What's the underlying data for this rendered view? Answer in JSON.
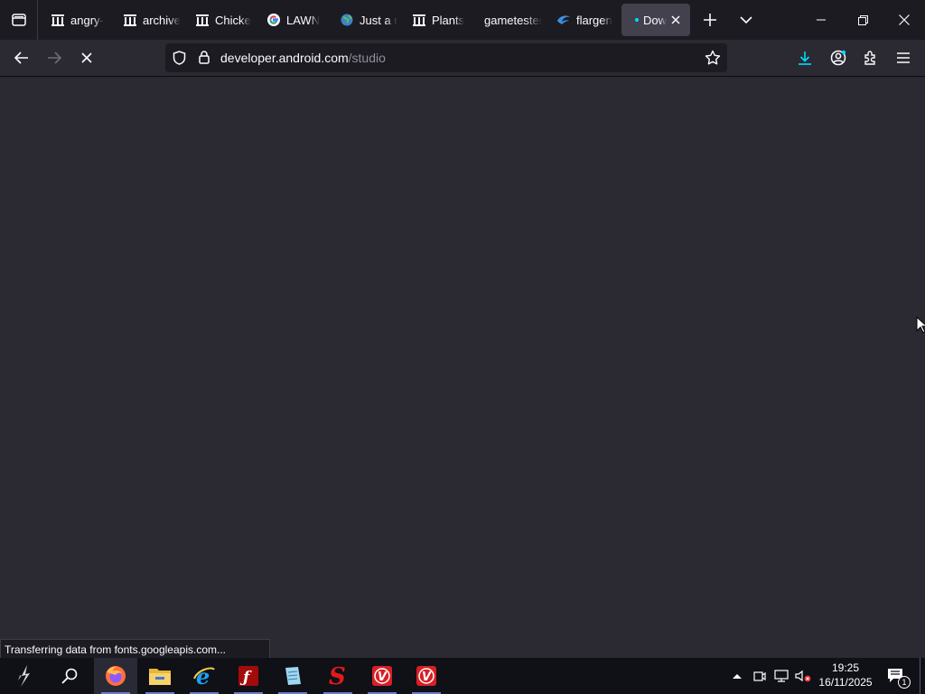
{
  "tabs": [
    {
      "title": "angry-",
      "icon": "archive-org-icon"
    },
    {
      "title": "archive",
      "icon": "archive-org-icon"
    },
    {
      "title": "Chicke",
      "icon": "archive-org-icon"
    },
    {
      "title": "LAWN",
      "icon": "google-icon"
    },
    {
      "title": "Just a r",
      "icon": "globe-icon"
    },
    {
      "title": "Plants",
      "icon": "archive-org-icon"
    },
    {
      "title": "gametester",
      "icon": ""
    },
    {
      "title": "flargen",
      "icon": "flargen-icon"
    },
    {
      "title": "Dow",
      "icon": "loading-dot-icon",
      "active": true
    }
  ],
  "address_bar": {
    "host": "developer.android.com",
    "path": "/studio"
  },
  "status_bar": {
    "text": "Transferring data from fonts.googleapis.com..."
  },
  "taskbar": {
    "apps": [
      "start-icon",
      "search-icon",
      "firefox-icon",
      "file-explorer-icon",
      "internet-explorer-icon",
      "flash-icon",
      "notepad-icon",
      "red-s-app-icon",
      "red-v-app-icon",
      "red-v-app-icon"
    ],
    "time": "19:25",
    "date": "16/11/2025",
    "notification_count": "1"
  },
  "colors": {
    "tabbar": "#1c1b22",
    "toolbar": "#2b2a33",
    "content": "#2b2a33",
    "download_accent": "#00ddff",
    "taskbar": "#101017"
  }
}
